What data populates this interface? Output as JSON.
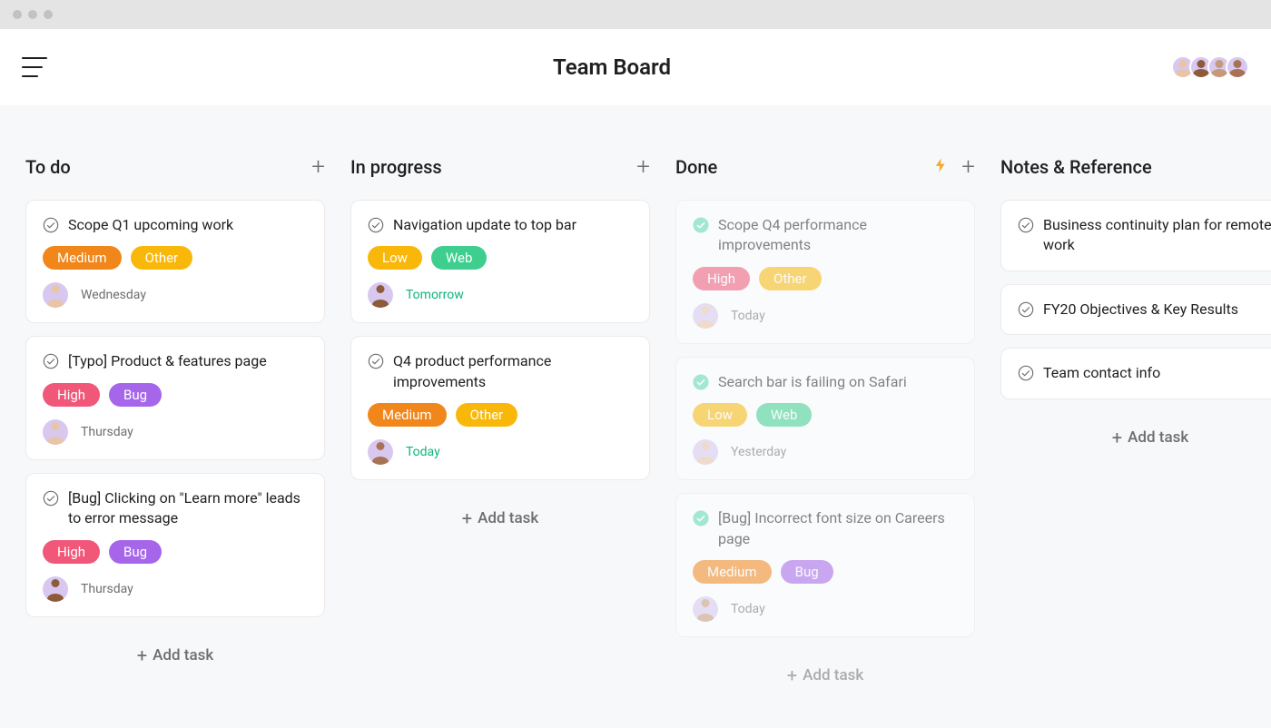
{
  "header": {
    "title": "Team Board"
  },
  "add_task_label": "Add task",
  "tag_colors": {
    "Medium": "#f1861a",
    "Low": "#f9b809",
    "High": "#f05779",
    "Other": "#f9b809",
    "Web": "#3ecf8e",
    "Bug": "#a666ea"
  },
  "columns": [
    {
      "title": "To do",
      "has_bolt": false,
      "faded": false,
      "cards": [
        {
          "title": "Scope Q1 upcoming work",
          "done": false,
          "tags": [
            "Medium",
            "Other"
          ],
          "assignee_tone": "tone1",
          "due": "Wednesday",
          "due_style": ""
        },
        {
          "title": "[Typo] Product & features page",
          "done": false,
          "tags": [
            "High",
            "Bug"
          ],
          "assignee_tone": "tone1",
          "due": "Thursday",
          "due_style": ""
        },
        {
          "title": "[Bug] Clicking on \"Learn more\" leads to error message",
          "done": false,
          "tags": [
            "High",
            "Bug"
          ],
          "assignee_tone": "tone3",
          "due": "Thursday",
          "due_style": ""
        }
      ]
    },
    {
      "title": "In progress",
      "has_bolt": false,
      "faded": false,
      "cards": [
        {
          "title": "Navigation update to top bar",
          "done": false,
          "tags": [
            "Low",
            "Web"
          ],
          "assignee_tone": "tone3",
          "due": "Tomorrow",
          "due_style": "green"
        },
        {
          "title": "Q4 product performance improvements",
          "done": false,
          "tags": [
            "Medium",
            "Other"
          ],
          "assignee_tone": "tone4",
          "due": "Today",
          "due_style": "green"
        }
      ]
    },
    {
      "title": "Done",
      "has_bolt": true,
      "faded": true,
      "cards": [
        {
          "title": "Scope Q4 performance improvements",
          "done": true,
          "tags": [
            "High",
            "Other"
          ],
          "assignee_tone": "tone1",
          "due": "Today",
          "due_style": ""
        },
        {
          "title": "Search bar is failing on Safari",
          "done": true,
          "tags": [
            "Low",
            "Web"
          ],
          "assignee_tone": "tone1",
          "due": "Yesterday",
          "due_style": ""
        },
        {
          "title": "[Bug] Incorrect font size on Careers page",
          "done": true,
          "tags": [
            "Medium",
            "Bug"
          ],
          "assignee_tone": "tone2",
          "due": "Today",
          "due_style": ""
        }
      ]
    },
    {
      "title": "Notes & Reference",
      "has_bolt": false,
      "faded": false,
      "cards": [
        {
          "title": "Business continuity plan for remote work",
          "done": false,
          "tags": [],
          "assignee_tone": null,
          "due": null
        },
        {
          "title": "FY20 Objectives & Key Results",
          "done": false,
          "tags": [],
          "assignee_tone": null,
          "due": null
        },
        {
          "title": "Team contact info",
          "done": false,
          "tags": [],
          "assignee_tone": null,
          "due": null
        }
      ]
    }
  ],
  "header_avatars": [
    "tone1",
    "tone3",
    "tone2",
    "tone4"
  ]
}
